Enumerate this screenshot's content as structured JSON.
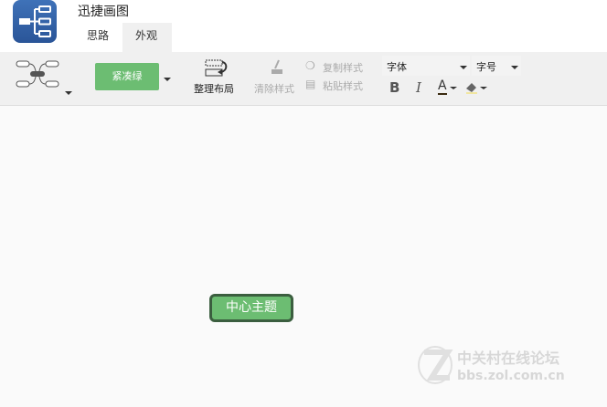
{
  "app": {
    "title": "迅捷画图"
  },
  "tabs": [
    {
      "label": "思路"
    },
    {
      "label": "外观"
    }
  ],
  "toolbar": {
    "theme_label": "紧凑绿",
    "arrange_label": "整理布局",
    "clear_style_label": "清除样式",
    "copy_style_label": "复制样式",
    "paste_style_label": "粘贴样式",
    "font_label": "字体",
    "font_size_label": "字号",
    "bold_label": "B",
    "italic_label": "I",
    "font_color_label": "A"
  },
  "canvas": {
    "center_topic": "中心主题"
  },
  "watermark": {
    "line1": "中关村在线论坛",
    "line2": "bbs.zol.com.cn"
  },
  "colors": {
    "theme_green": "#6cbd72",
    "topic_border": "#3b5e3f",
    "logo_blue": "#2f5fa6"
  }
}
